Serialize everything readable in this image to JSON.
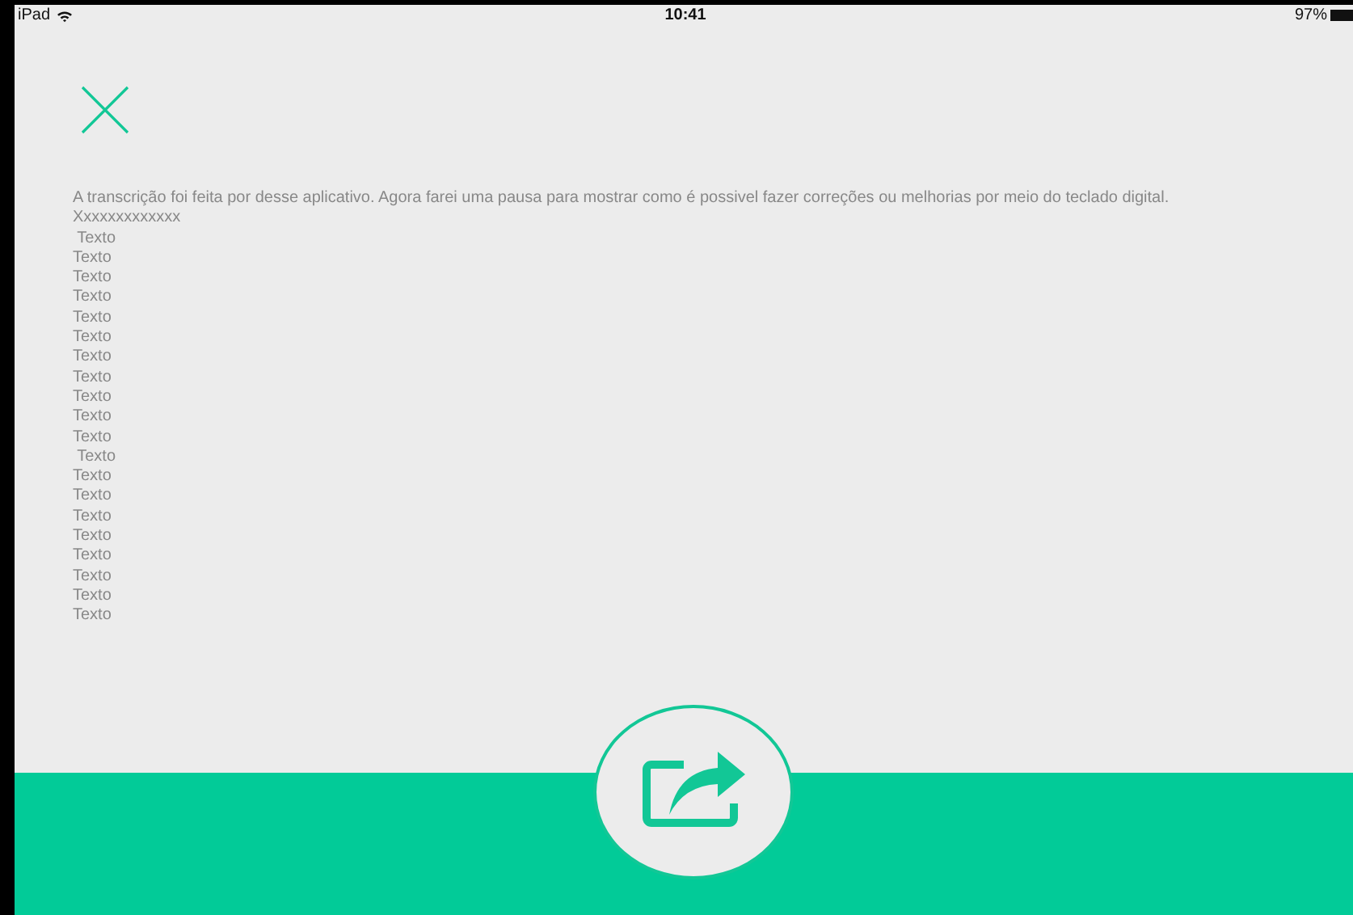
{
  "status_bar": {
    "device": "iPad",
    "time": "10:41",
    "battery": "97%"
  },
  "transcript": {
    "paragraph": "A transcrição foi feita por desse aplicativo. Agora farei uma pausa para mostrar como é possivel fazer correções ou melhorias por meio do teclado digital.",
    "lines": [
      "Xxxxxxxxxxxxx",
      " Texto",
      "Texto",
      "Texto",
      "Texto",
      "Texto",
      "Texto",
      "Texto",
      "Texto",
      "Texto",
      "Texto",
      "Texto",
      " Texto",
      "Texto",
      "Texto",
      "Texto",
      "Texto",
      "Texto",
      "Texto",
      "Texto",
      "Texto"
    ]
  }
}
